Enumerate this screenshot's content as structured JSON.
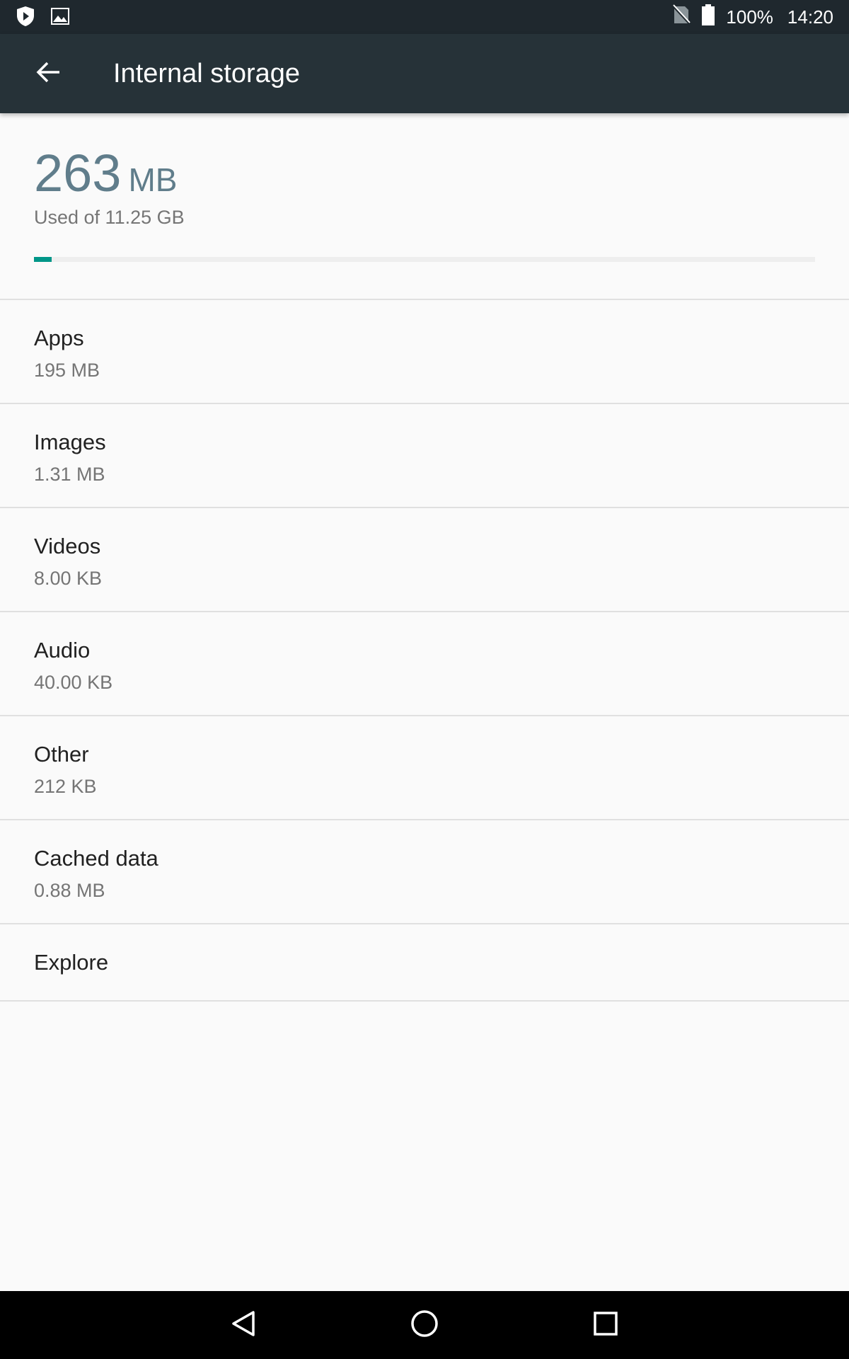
{
  "status_bar": {
    "battery_percent": "100%",
    "time": "14:20",
    "icons": [
      "shield-icon",
      "image-icon",
      "no-sim-icon",
      "battery-icon"
    ]
  },
  "app_bar": {
    "title": "Internal storage",
    "back_icon": "arrow-back-icon"
  },
  "summary": {
    "used_value": "263",
    "used_unit": "MB",
    "subtitle": "Used of 11.25 GB",
    "progress_fraction": 0.023,
    "accent_color": "#009688"
  },
  "categories": [
    {
      "label": "Apps",
      "value": "195 MB"
    },
    {
      "label": "Images",
      "value": "1.31 MB"
    },
    {
      "label": "Videos",
      "value": "8.00 KB"
    },
    {
      "label": "Audio",
      "value": "40.00 KB"
    },
    {
      "label": "Other",
      "value": "212 KB"
    },
    {
      "label": "Cached data",
      "value": "0.88 MB"
    }
  ],
  "explore": {
    "label": "Explore"
  },
  "nav_bar": {
    "icons": [
      "back-triangle-icon",
      "home-circle-icon",
      "recents-square-icon"
    ]
  }
}
